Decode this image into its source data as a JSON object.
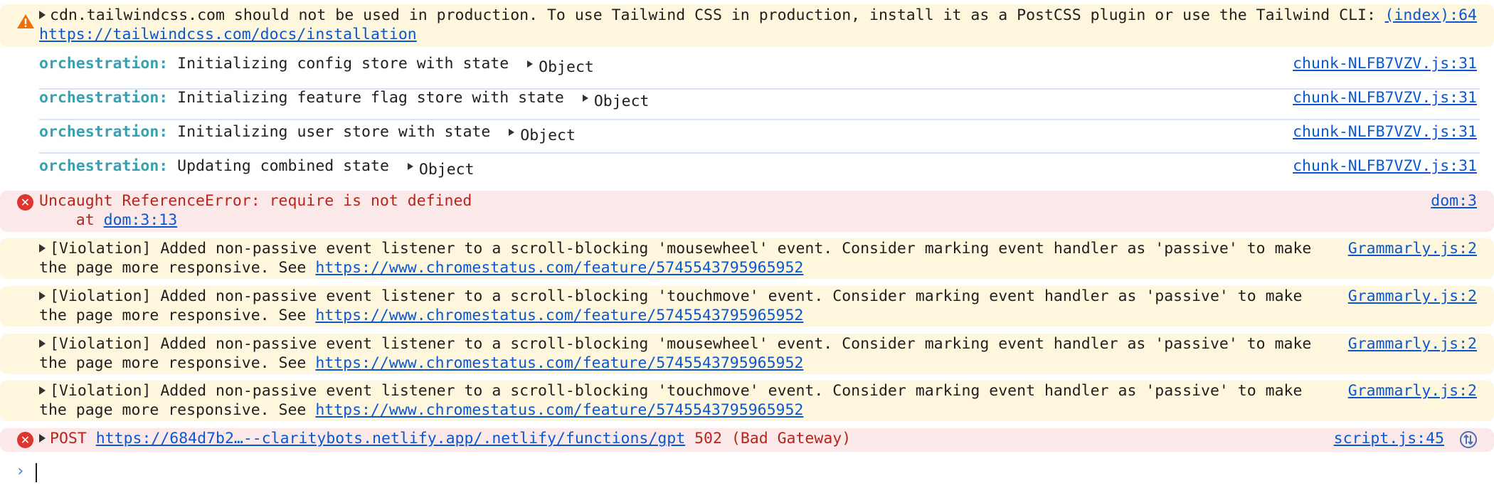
{
  "warning_tailwind": {
    "text": "cdn.tailwindcss.com should not be used in production. To use Tailwind CSS in production, install it as a PostCSS plugin or use the Tailwind CLI: ",
    "link": "https://tailwindcss.com/docs/installation",
    "source": "(index):64"
  },
  "orchestration": [
    {
      "label": "orchestration:",
      "message": "Initializing config store with state",
      "object": "Object",
      "source": "chunk-NLFB7VZV.js:31"
    },
    {
      "label": "orchestration:",
      "message": "Initializing feature flag store with state",
      "object": "Object",
      "source": "chunk-NLFB7VZV.js:31"
    },
    {
      "label": "orchestration:",
      "message": "Initializing user store with state",
      "object": "Object",
      "source": "chunk-NLFB7VZV.js:31"
    },
    {
      "label": "orchestration:",
      "message": "Updating combined state",
      "object": "Object",
      "source": "chunk-NLFB7VZV.js:31"
    }
  ],
  "reference_error": {
    "message": "Uncaught ReferenceError: require is not defined",
    "at_prefix": "    at ",
    "at_link": "dom:3:13",
    "source": "dom:3"
  },
  "violations": [
    {
      "text": "[Violation] Added non-passive event listener to a scroll-blocking 'mousewheel' event. Consider marking event handler as 'passive' to make the page more responsive. See ",
      "link": "https://www.chromestatus.com/feature/5745543795965952",
      "source": "Grammarly.js:2"
    },
    {
      "text": "[Violation] Added non-passive event listener to a scroll-blocking 'touchmove' event. Consider marking event handler as 'passive' to make the page more responsive. See ",
      "link": "https://www.chromestatus.com/feature/5745543795965952",
      "source": "Grammarly.js:2"
    },
    {
      "text": "[Violation] Added non-passive event listener to a scroll-blocking 'mousewheel' event. Consider marking event handler as 'passive' to make the page more responsive. See ",
      "link": "https://www.chromestatus.com/feature/5745543795965952",
      "source": "Grammarly.js:2"
    },
    {
      "text": "[Violation] Added non-passive event listener to a scroll-blocking 'touchmove' event. Consider marking event handler as 'passive' to make the page more responsive. See ",
      "link": "https://www.chromestatus.com/feature/5745543795965952",
      "source": "Grammarly.js:2"
    }
  ],
  "post_error": {
    "method": "POST ",
    "url": "https://684d7b2…--claritybots.netlify.app/.netlify/functions/gpt",
    "status": " 502 (Bad Gateway)",
    "source": "script.js:45"
  },
  "colors": {
    "warning_bg": "#fef7dd",
    "error_bg": "#fbe9ea",
    "error_icon": "#dc362e",
    "warning_icon": "#e8710a",
    "link": "#0b57d0",
    "orchestration_label": "#3aa0b1"
  },
  "icons": {
    "warning": "warning-triangle-icon",
    "error": "error-circle-icon",
    "expand": "expand-triangle-icon",
    "replay": "replay-network-icon",
    "prompt": "console-prompt-chevron-icon"
  }
}
